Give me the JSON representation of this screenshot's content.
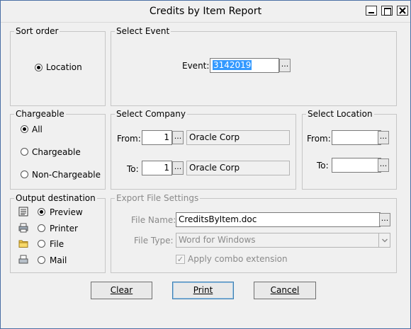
{
  "window": {
    "title": "Credits by Item Report"
  },
  "sort_order": {
    "legend": "Sort order",
    "option": "Location"
  },
  "select_event": {
    "legend": "Select Event",
    "event_label": "Event:",
    "event_value": "3142019",
    "browse": "..."
  },
  "chargeable": {
    "legend": "Chargeable",
    "options": [
      "All",
      "Chargeable",
      "Non-Chargeable"
    ],
    "selected": "All"
  },
  "select_company": {
    "legend": "Select Company",
    "from_label": "From:",
    "from_value": "1",
    "from_name": "Oracle Corp",
    "to_label": "To:",
    "to_value": "1",
    "to_name": "Oracle Corp",
    "browse": "..."
  },
  "select_location": {
    "legend": "Select Location",
    "from_label": "From:",
    "from_value": "",
    "to_label": "To:",
    "to_value": "",
    "browse": "..."
  },
  "output_destination": {
    "legend": "Output destination",
    "options": [
      "Preview",
      "Printer",
      "File",
      "Mail"
    ],
    "selected": "Preview",
    "icons": [
      "preview-icon",
      "printer-icon",
      "folder-icon",
      "mail-icon"
    ]
  },
  "export_settings": {
    "legend": "Export  File Settings",
    "file_name_label": "File Name:",
    "file_name_value": "CreditsByItem.doc",
    "file_type_label": "File Type:",
    "file_type_value": "Word for Windows",
    "apply_combo": "Apply combo extension",
    "apply_combo_checked": true,
    "browse": "..."
  },
  "buttons": {
    "clear": "Clear",
    "print": "Print",
    "cancel": "Cancel"
  },
  "colors": {
    "selection": "#3399ff",
    "window_bg": "#f0f0f0",
    "disabled_text": "#8a8a8a"
  }
}
